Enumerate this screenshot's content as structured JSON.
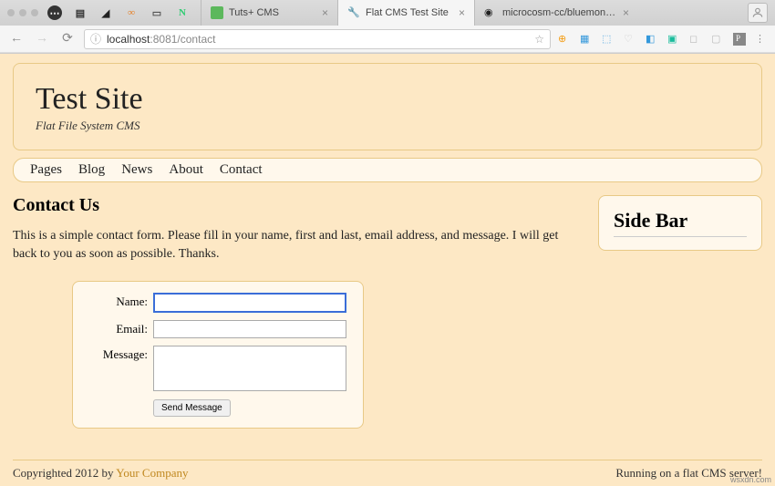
{
  "browser": {
    "tabs": [
      {
        "title": "Tuts+ CMS"
      },
      {
        "title": "Flat CMS Test Site"
      },
      {
        "title": "microcosm-cc/bluemonday: b"
      }
    ],
    "url_host": "localhost",
    "url_port": ":8081",
    "url_path": "/contact"
  },
  "site": {
    "title": "Test Site",
    "subtitle": "Flat File System CMS"
  },
  "nav": {
    "items": [
      "Pages",
      "Blog",
      "News",
      "About",
      "Contact"
    ]
  },
  "main": {
    "heading": "Contact Us",
    "intro": "This is a simple contact form. Please fill in your name, first and last, email address, and message. I will get back to you as soon as possible. Thanks."
  },
  "form": {
    "name_label": "Name:",
    "email_label": "Email:",
    "message_label": "Message:",
    "send_label": "Send Message"
  },
  "sidebar": {
    "heading": "Side Bar"
  },
  "footer": {
    "left_prefix": "Copyrighted 2012 by ",
    "company": "Your Company",
    "right": "Running on a flat CMS server!"
  },
  "watermark": "wsxdn.com"
}
